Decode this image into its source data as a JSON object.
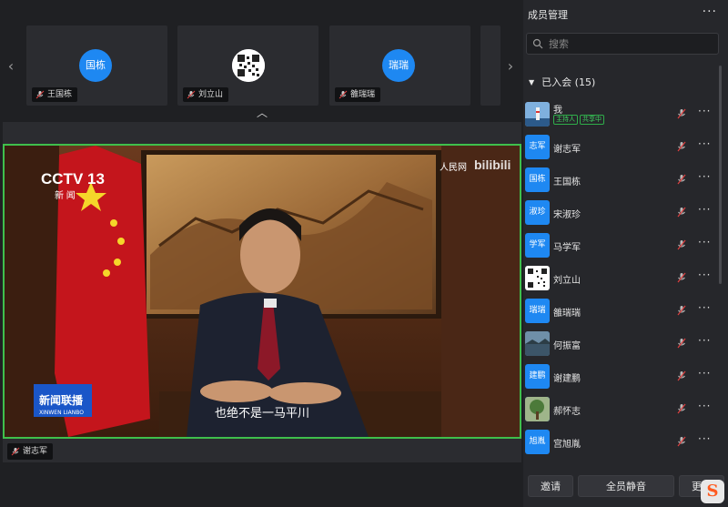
{
  "top_strip": {
    "tiles": [
      {
        "avatar_text": "国栋",
        "name": "王国栋",
        "avatar_type": "text"
      },
      {
        "avatar_text": "",
        "name": "刘立山",
        "avatar_type": "qr"
      },
      {
        "avatar_text": "瑞瑞",
        "name": "雒瑞瑞",
        "avatar_type": "text"
      }
    ]
  },
  "main_video": {
    "speaker_name": "谢志军",
    "subtitle": "也绝不是一马平川",
    "channel_logo": "CCTV 13",
    "channel_sub": "新 闻",
    "watermark_left": "人民网",
    "watermark_right": "bilibili",
    "news_logo_line1": "新闻联播",
    "news_logo_line2": "XINWEN LIANBO"
  },
  "panel": {
    "title": "成员管理",
    "more_icon": "ellipsis-icon",
    "search_placeholder": "搜索",
    "section_label": "已入会 (15)",
    "members": [
      {
        "avatar_text": "",
        "avatar_type": "photo-lighthouse",
        "name": "我",
        "badges": [
          "主持人",
          "共享中"
        ]
      },
      {
        "avatar_text": "志军",
        "avatar_type": "text",
        "name": "谢志军"
      },
      {
        "avatar_text": "国栋",
        "avatar_type": "text",
        "name": "王国栋"
      },
      {
        "avatar_text": "淑珍",
        "avatar_type": "text",
        "name": "宋淑珍"
      },
      {
        "avatar_text": "学军",
        "avatar_type": "text",
        "name": "马学军"
      },
      {
        "avatar_text": "",
        "avatar_type": "qr",
        "name": "刘立山"
      },
      {
        "avatar_text": "瑞瑞",
        "avatar_type": "text",
        "name": "雒瑞瑞"
      },
      {
        "avatar_text": "",
        "avatar_type": "photo-lake",
        "name": "何振富"
      },
      {
        "avatar_text": "建鹏",
        "avatar_type": "text",
        "name": "谢建鹏"
      },
      {
        "avatar_text": "",
        "avatar_type": "photo-tree",
        "name": "郝怀志"
      },
      {
        "avatar_text": "旭胤",
        "avatar_type": "text",
        "name": "宫旭胤"
      }
    ],
    "buttons": {
      "invite": "邀请",
      "mute_all": "全员静音",
      "more": "更多"
    }
  },
  "colors": {
    "accent_blue": "#1e88f2",
    "active_speaker_border": "#3fbf4c",
    "host_badge": "#2fae4a"
  }
}
